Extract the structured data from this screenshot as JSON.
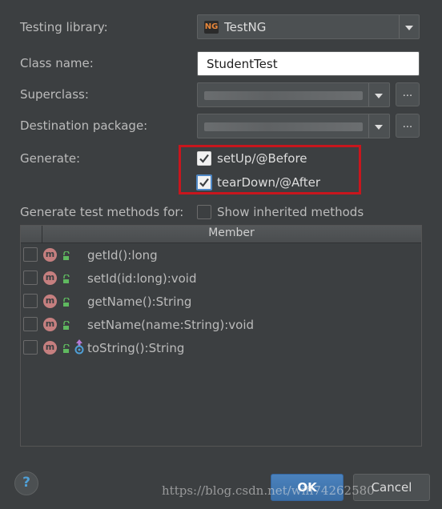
{
  "form": {
    "testing_library_label": "Testing library:",
    "testing_library_value": "TestNG",
    "testing_library_logo": "NG",
    "class_name_label": "Class name:",
    "class_name_value": "StudentTest",
    "superclass_label": "Superclass:",
    "destination_label": "Destination package:",
    "browse_label": "...",
    "generate_label": "Generate:",
    "generate_options": [
      {
        "label": "setUp/@Before",
        "checked": true
      },
      {
        "label": "tearDown/@After",
        "checked": true
      }
    ],
    "methods_for_label": "Generate test methods for:",
    "show_inherited_label": "Show inherited methods",
    "highlight_color": "#c8161d"
  },
  "table": {
    "header": "Member",
    "rows": [
      {
        "marker": "m",
        "name": "getId():long",
        "checked": false
      },
      {
        "marker": "m",
        "name": "setId(id:long):void",
        "checked": false
      },
      {
        "marker": "m",
        "name": "getName():String",
        "checked": false
      },
      {
        "marker": "m",
        "name": "setName(name:String):void",
        "checked": false
      },
      {
        "marker": "m",
        "name": "toString():String",
        "checked": false,
        "override": true
      }
    ]
  },
  "footer": {
    "help": "?",
    "ok": "OK",
    "cancel": "Cancel",
    "watermark": "https://blog.csdn.net/wifi74262580"
  }
}
